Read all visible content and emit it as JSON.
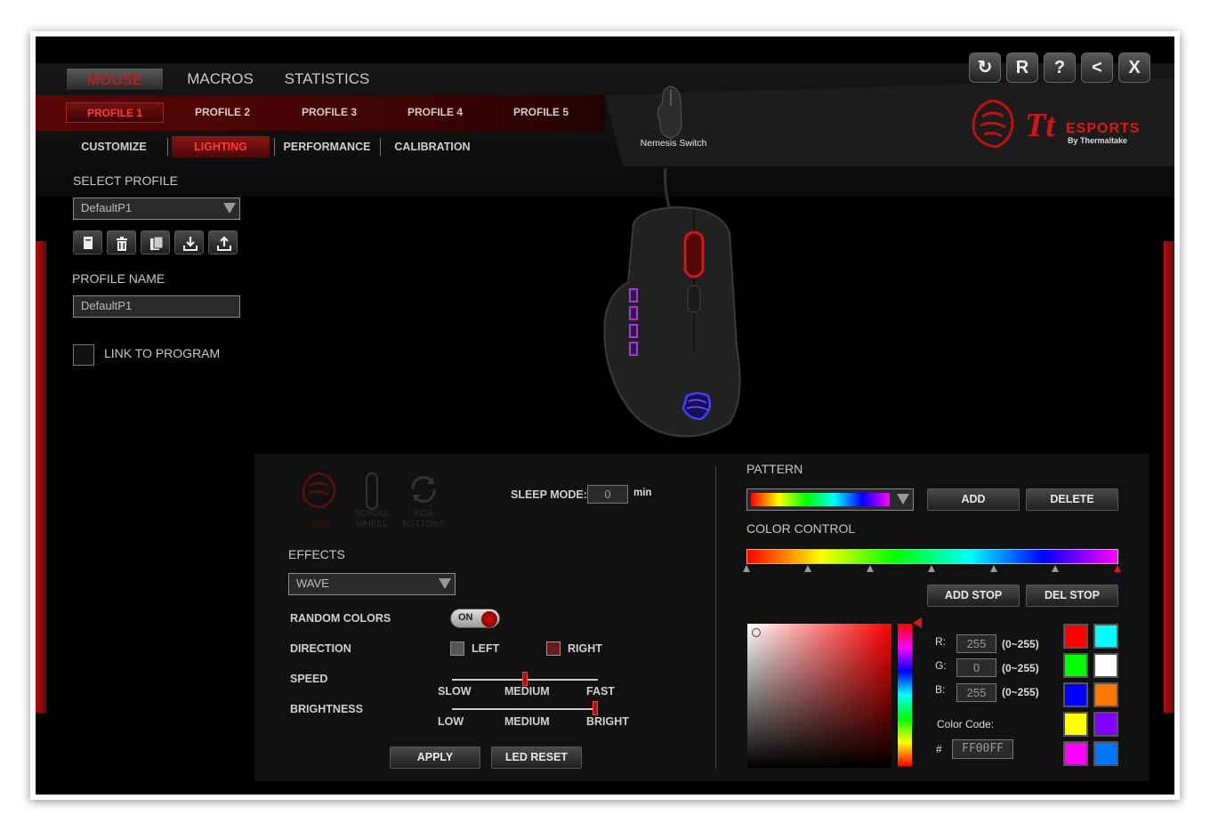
{
  "main_tabs": [
    {
      "label": "MOUSE",
      "active": true
    },
    {
      "label": "MACROS",
      "active": false
    },
    {
      "label": "STATISTICS",
      "active": false
    }
  ],
  "profile_tabs": [
    {
      "label": "PROFILE 1",
      "active": true
    },
    {
      "label": "PROFILE 2",
      "active": false
    },
    {
      "label": "PROFILE 3",
      "active": false
    },
    {
      "label": "PROFILE 4",
      "active": false
    },
    {
      "label": "PROFILE 5",
      "active": false
    }
  ],
  "sub_tabs": [
    {
      "label": "CUSTOMIZE",
      "active": false
    },
    {
      "label": "LIGHTING",
      "active": true
    },
    {
      "label": "PERFORMANCE",
      "active": false
    },
    {
      "label": "CALIBRATION",
      "active": false
    }
  ],
  "device": {
    "name": "Nemesis Switch"
  },
  "brand": {
    "main": "ESPORTS",
    "sub": "By Thermaltake",
    "accent": "#e01616"
  },
  "window_buttons": [
    {
      "icon": "refresh-icon",
      "glyph": "C"
    },
    {
      "icon": "reset-icon",
      "glyph": "R"
    },
    {
      "icon": "help-icon",
      "glyph": "?"
    },
    {
      "icon": "minimize-icon",
      "glyph": "<"
    },
    {
      "icon": "close-icon",
      "glyph": "X"
    }
  ],
  "sidebar": {
    "select_profile_label": "SELECT PROFILE",
    "selected_profile": "DefaultP1",
    "profile_actions": [
      "new-profile-icon",
      "delete-profile-icon",
      "copy-profile-icon",
      "import-icon",
      "export-icon"
    ],
    "profile_name_label": "PROFILE NAME",
    "profile_name_value": "DefaultP1",
    "link_to_program_label": "LINK TO PROGRAM"
  },
  "lighting": {
    "zones": [
      {
        "label": "LOGO",
        "active": true
      },
      {
        "label": "SCROLL WHEEL",
        "active": false
      },
      {
        "label": "SIDE BUTTONS",
        "active": false
      }
    ],
    "sleep_mode_label": "SLEEP MODE:",
    "sleep_mode_value": "0",
    "sleep_mode_unit": "min",
    "effects_label": "EFFECTS",
    "effect_selected": "WAVE",
    "random_colors_label": "RANDOM COLORS",
    "random_colors_state": "ON",
    "direction_label": "DIRECTION",
    "direction_left": "LEFT",
    "direction_right": "RIGHT",
    "direction_selected": "RIGHT",
    "speed_label": "SPEED",
    "speed_ticks": [
      "SLOW",
      "MEDIUM",
      "FAST"
    ],
    "speed_value": 0.5,
    "brightness_label": "BRIGHTNESS",
    "brightness_ticks": [
      "LOW",
      "MEDIUM",
      "BRIGHT"
    ],
    "brightness_value": 1.0,
    "apply_label": "APPLY",
    "led_reset_label": "LED RESET"
  },
  "color": {
    "pattern_label": "PATTERN",
    "add_label": "ADD",
    "delete_label": "DELETE",
    "color_control_label": "COLOR CONTROL",
    "add_stop_label": "ADD STOP",
    "del_stop_label": "DEL STOP",
    "r_label": "R:",
    "g_label": "G:",
    "b_label": "B:",
    "r_value": "255",
    "g_value": "0",
    "b_value": "255",
    "range": "(0~255)",
    "color_code_label": "Color Code:",
    "hash": "#",
    "color_code_value": "FF00FF",
    "swatches": [
      "#ff0000",
      "#00ffff",
      "#00ff00",
      "#ffffff",
      "#0000ff",
      "#ff7700",
      "#ffff00",
      "#7f00ff",
      "#ff00ff",
      "#0077ff"
    ]
  }
}
